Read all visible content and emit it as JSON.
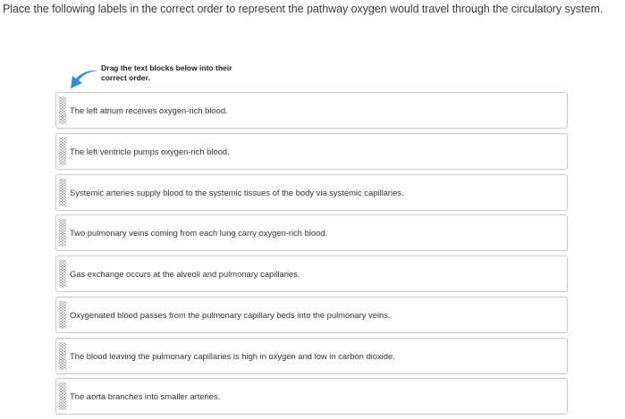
{
  "question": {
    "text": "Place the following labels in the correct order to represent the pathway oxygen would travel through the circulatory system."
  },
  "instruction": {
    "icon": "curved-arrow-icon",
    "line1": "Drag the text blocks below into their",
    "line2": "correct order."
  },
  "colors": {
    "arrow": "#2f8fdc",
    "border": "#c8c8c8",
    "grip": "#8a8a8a"
  },
  "items": [
    {
      "label": "The left atrium receives oxygen-rich blood."
    },
    {
      "label": "The left ventricle pumps oxygen-rich blood."
    },
    {
      "label": "Systemic arteries supply blood to the systemic tissues of the body via systemic capillaries."
    },
    {
      "label": "Two pulmonary veins coming from each lung carry oxygen-rich blood."
    },
    {
      "label": "Gas exchange occurs at the alveoli and pulmonary capillaries."
    },
    {
      "label": "Oxygenated blood passes from the pulmonary capillary beds into the pulmonary veins."
    },
    {
      "label": "The blood leaving the pulmonary capillaries is high in oxygen and low in carbon dioxide."
    },
    {
      "label": "The aorta branches into smaller arteries."
    }
  ]
}
